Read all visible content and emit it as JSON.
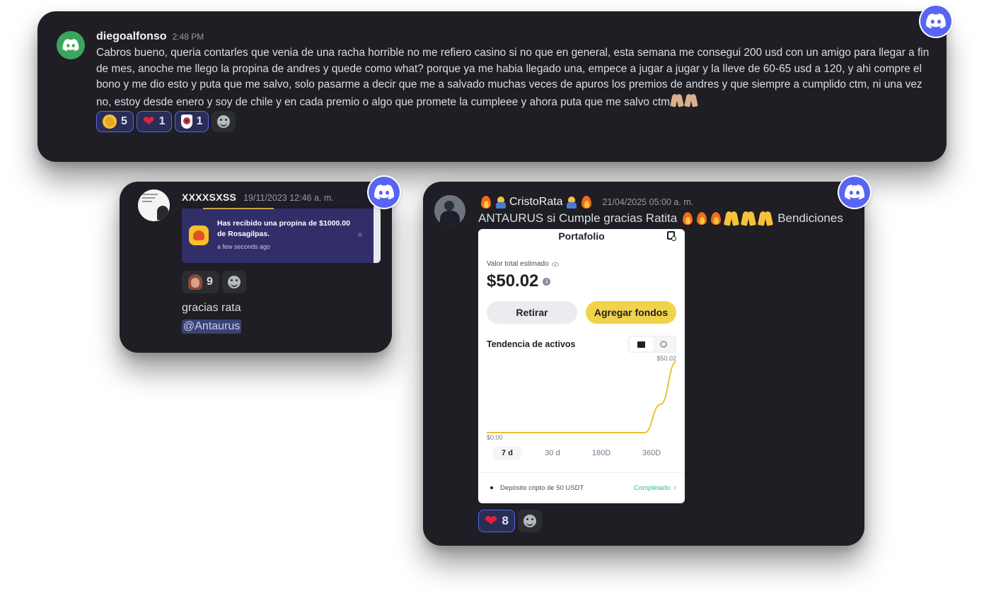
{
  "msg1": {
    "username": "diegoalfonso",
    "time": "2:48 PM",
    "text": "Cabros bueno, queria contarles que venia de una racha horrible no me refiero casino si no que en general, esta semana me consegui 200 usd con un amigo para llegar a fin de mes, anoche me llego la propina de andres y quede como what? porque ya me habia llegado una, empece a jugar a jugar y la lleve de 60-65 usd a 120, y ahi compre el bono y me dio esto y puta que me salvo, solo pasarme a decir que me a salvado muchas veces de apuros los premios de andres y que siempre a cumplido ctm, ni una vez no, estoy desde enero y soy de chile y en cada premio o algo que promete la cumpleee y ahora puta que me salvo ctm",
    "reactions": [
      {
        "icon": "clapping-hands",
        "count": "5"
      },
      {
        "icon": "red-heart",
        "count": "1"
      },
      {
        "icon": "club-crest",
        "count": "1"
      }
    ]
  },
  "msg2": {
    "username": "XXXXSXSS",
    "time": "19/11/2023 12:46 a. m.",
    "notification_text": "Has recibido una propina de $1000.00 de Rosagilpas.",
    "notification_time": "a few seconds ago",
    "reaction_count": "9",
    "text": "gracias rata",
    "mention": "@Antaurus"
  },
  "msg3": {
    "username": "CristoRata",
    "time": "21/04/2025 05:00 a. m.",
    "text_lead": "ANTAURUS si Cumple gracias Ratita",
    "text_tail": "Bendiciones",
    "reaction_count": "8",
    "portfolio": {
      "title": "Portafolio",
      "valor_label": "Valor total estimado",
      "amount": "$50.02",
      "btn_retirar": "Retirar",
      "btn_agregar": "Agregar fondos",
      "tendencia_label": "Tendencia de activos",
      "max_label": "$50.02",
      "min_label": "$0.00",
      "ranges": [
        "7 d",
        "30 d",
        "180D",
        "360D"
      ],
      "deposit_text": "Depósito cripto de 50 USDT",
      "deposit_status": "Completado"
    }
  },
  "chart_data": {
    "type": "line",
    "title": "Tendencia de activos",
    "x": [
      0,
      1,
      2,
      3,
      4,
      5,
      6,
      7,
      8,
      9,
      10,
      11,
      12
    ],
    "series": [
      {
        "values": [
          0,
          0,
          0,
          0,
          0,
          0,
          0,
          0,
          0,
          0,
          0,
          20,
          50.02
        ]
      }
    ],
    "y_labels": [
      "$0.00",
      "$50.02"
    ],
    "ylim": [
      0,
      50.02
    ],
    "active_range": "7 d",
    "grid": false
  },
  "colors": {
    "card_bg": "#1f1e24",
    "discord_blurple": "#5865f2",
    "accent_yellow": "#f0d34b",
    "line_yellow": "#e9c234",
    "mention_bg": "#3c4270",
    "notif_bg": "#322e6a"
  }
}
